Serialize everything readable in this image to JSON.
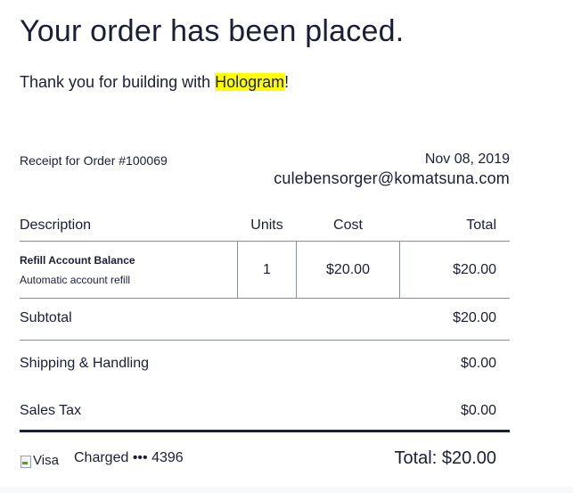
{
  "header": {
    "title": "Your order has been placed.",
    "thanks_prefix": "Thank you for building with ",
    "brand": "Hologram",
    "thanks_suffix": "!"
  },
  "receipt": {
    "label": "Receipt for Order #100069",
    "date": "Nov 08, 2019",
    "email": "culebensorger@komatsuna.com"
  },
  "table": {
    "columns": [
      "Description",
      "Units",
      "Cost",
      "Total"
    ],
    "rows": [
      {
        "name": "Refill Account Balance",
        "subtitle": "Automatic account refill",
        "units": "1",
        "cost": "$20.00",
        "total": "$20.00"
      }
    ]
  },
  "summary": {
    "subtotal_label": "Subtotal",
    "subtotal_value": "$20.00",
    "shipping_label": "Shipping & Handling",
    "shipping_value": "$0.00",
    "tax_label": "Sales Tax",
    "tax_value": "$0.00"
  },
  "payment": {
    "card_alt": "Visa",
    "charged": "Charged ••• 4396",
    "total": "Total: $20.00"
  },
  "colors": {
    "text": "#1a1f36",
    "highlight": "#ffff00",
    "rule": "#8a8f98"
  }
}
